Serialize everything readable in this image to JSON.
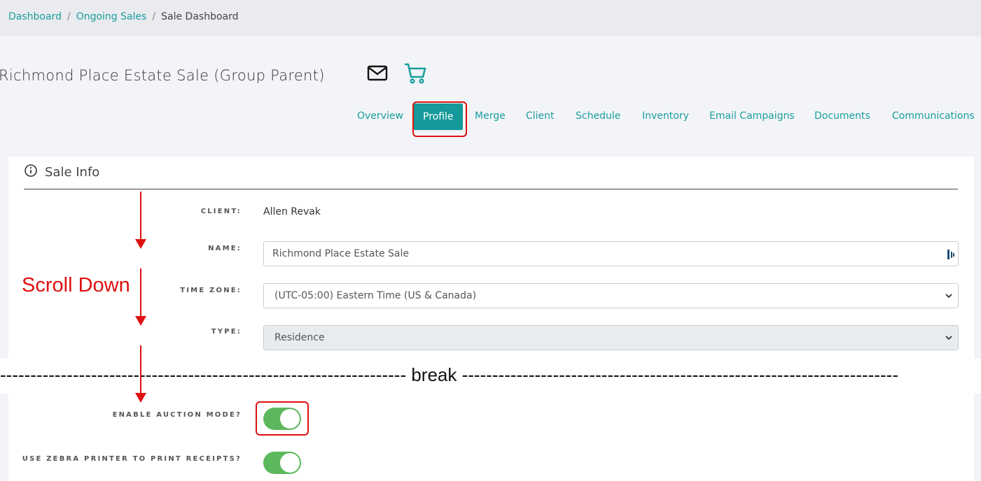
{
  "breadcrumb": {
    "items": [
      "Dashboard",
      "Ongoing Sales"
    ],
    "separator": "/",
    "current": "Sale Dashboard"
  },
  "page": {
    "title": "Richmond Place Estate Sale (Group Parent)"
  },
  "tabs": [
    "Overview",
    "Profile",
    "Merge",
    "Client",
    "Schedule",
    "Inventory",
    "Email Campaigns",
    "Documents",
    "Communications"
  ],
  "active_tab": "Profile",
  "sale_info": {
    "header": "Sale Info",
    "client_label": "CLIENT:",
    "client_value": "Allen Revak",
    "name_label": "NAME:",
    "name_value": "Richmond Place Estate Sale",
    "timezone_label": "TIME ZONE:",
    "timezone_value": "(UTC-05:00) Eastern Time (US & Canada)",
    "type_label": "TYPE:",
    "type_value": "Residence",
    "auction_label": "ENABLE AUCTION MODE?",
    "auction_on": true,
    "zebra_label": "USE ZEBRA PRINTER TO PRINT RECEIPTS?",
    "zebra_on": true
  },
  "annotations": {
    "scroll_text": "Scroll Down",
    "break_text": "------------------------------------------------------------------- break ------------------------------------------------------------------------"
  },
  "colors": {
    "accent": "#1a9e9e",
    "active_tab_bg": "#15999a",
    "toggle_on": "#5cb85c",
    "annotation_red": "#e01010"
  }
}
